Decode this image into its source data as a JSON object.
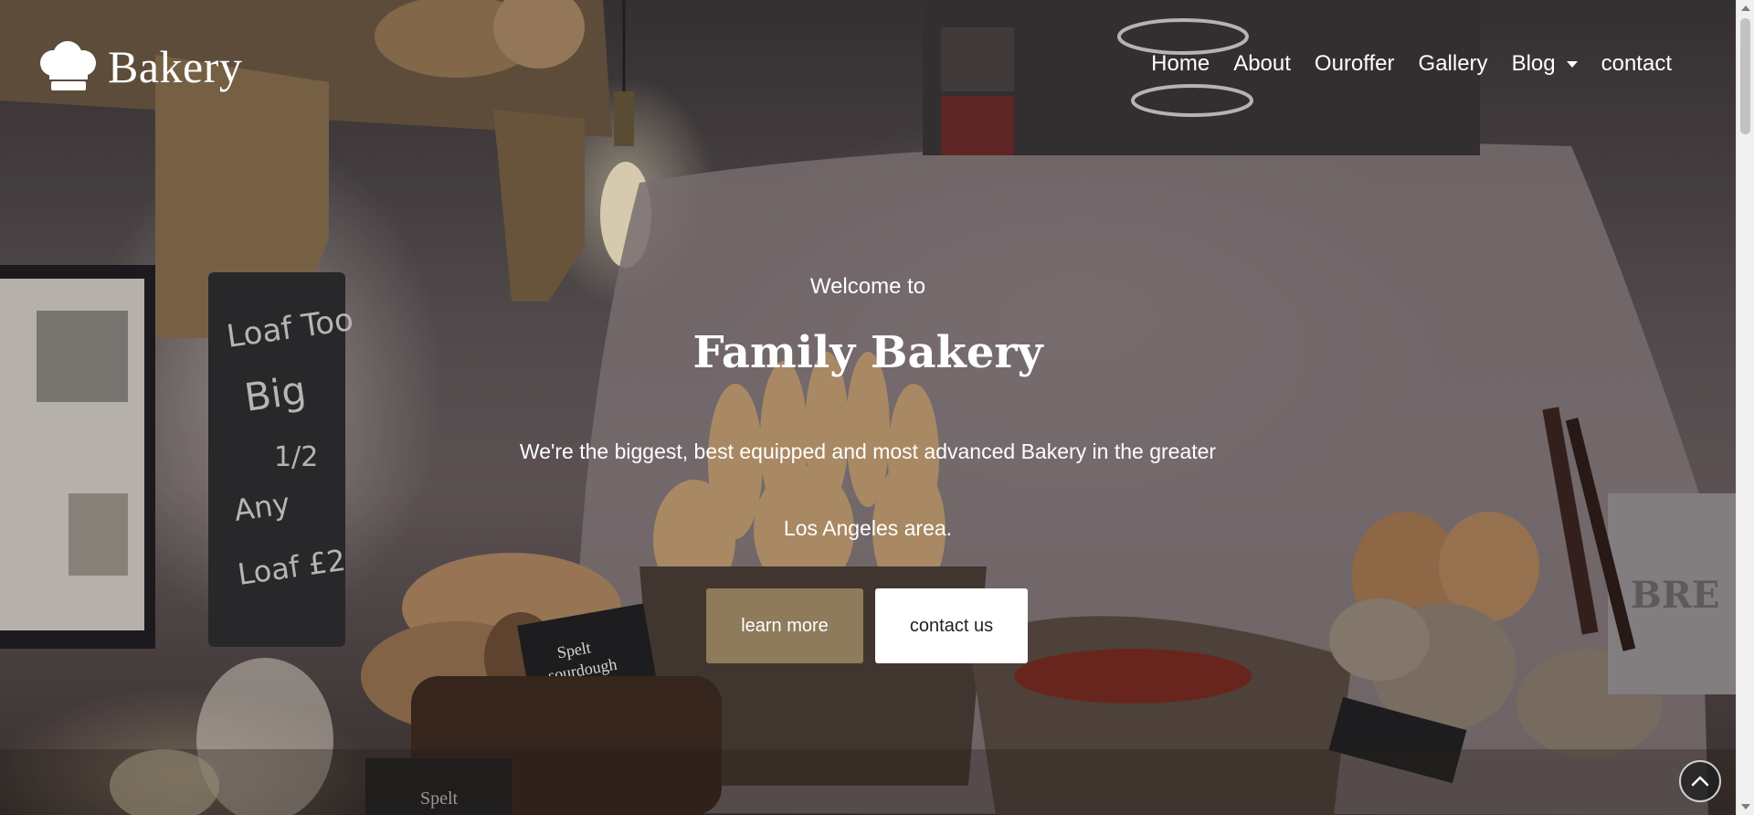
{
  "brand": {
    "name": "Bakery",
    "icon": "chef-hat-icon"
  },
  "nav": {
    "items": [
      {
        "label": "Home"
      },
      {
        "label": "About"
      },
      {
        "label": "Ouroffer"
      },
      {
        "label": "Gallery"
      },
      {
        "label": "Blog",
        "has_dropdown": true
      },
      {
        "label": "contact"
      }
    ]
  },
  "hero": {
    "welcome": "Welcome to",
    "title": "Family Bakery",
    "description_line1": "We're the biggest, best equipped and most advanced Bakery in the greater",
    "description_line2": "Los Angeles area.",
    "primary_button": "learn more",
    "secondary_button": "contact us",
    "background_image": "bakery-bread-baskets-photo"
  },
  "scroll_top": {
    "icon": "chevron-up-icon"
  },
  "colors": {
    "primary_button": "#8e7b5b",
    "secondary_button": "#ffffff",
    "text": "#ffffff"
  }
}
